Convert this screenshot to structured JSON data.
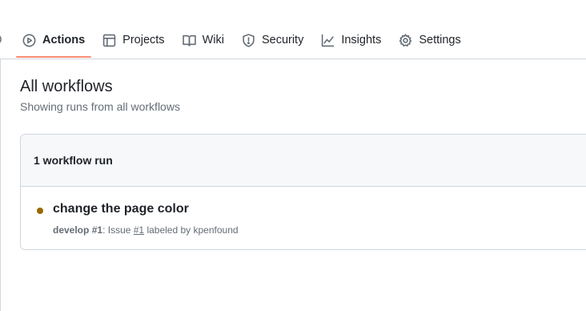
{
  "nav": {
    "tabs": [
      {
        "label": "Actions",
        "icon": "play-icon",
        "active": true
      },
      {
        "label": "Projects",
        "icon": "table-icon",
        "active": false
      },
      {
        "label": "Wiki",
        "icon": "book-icon",
        "active": false
      },
      {
        "label": "Security",
        "icon": "shield-icon",
        "active": false
      },
      {
        "label": "Insights",
        "icon": "graph-icon",
        "active": false
      },
      {
        "label": "Settings",
        "icon": "gear-icon",
        "active": false
      }
    ]
  },
  "main": {
    "title": "All workflows",
    "subtitle": "Showing runs from all workflows",
    "runs_box": {
      "header": "1 workflow run",
      "runs": [
        {
          "title": "change the page color",
          "branch": "develop",
          "run_number": "#1",
          "meta_prefix": ": Issue ",
          "issue_link": "#1",
          "meta_suffix": " labeled by kpenfound",
          "status_color": "#9a6700"
        }
      ]
    }
  },
  "colors": {
    "accent_underline": "#fd8c73",
    "border": "#d0d7de",
    "muted_text": "#656d76",
    "header_bg": "#f6f8fa"
  }
}
